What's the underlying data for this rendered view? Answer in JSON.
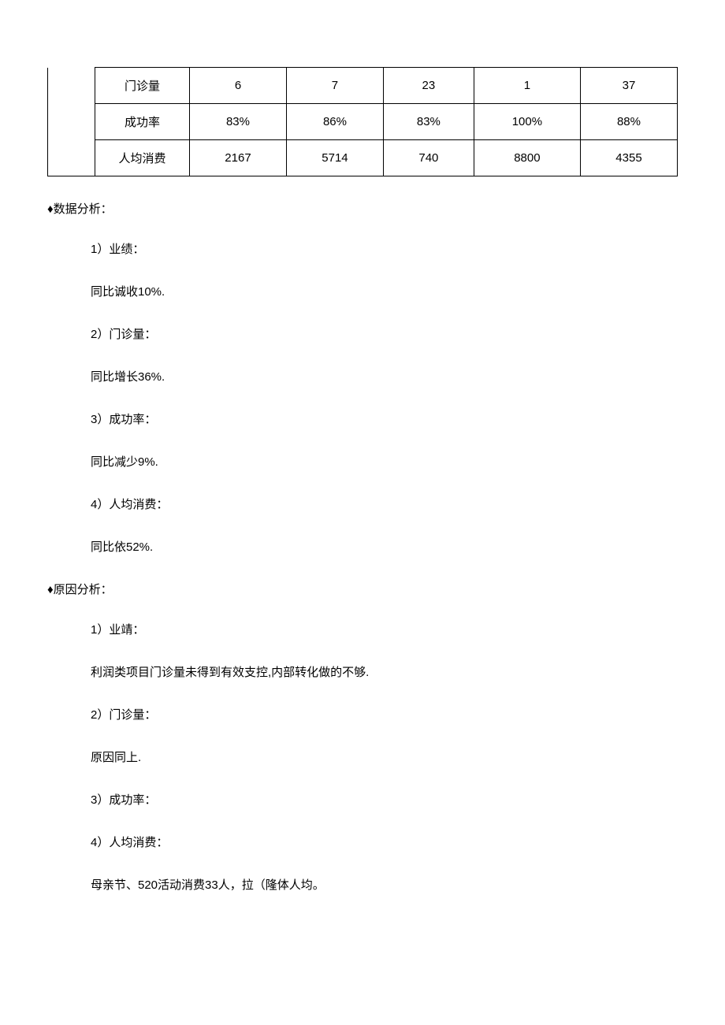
{
  "table": {
    "rows": [
      {
        "label": "门诊量",
        "c1": "6",
        "c2": "7",
        "c3": "23",
        "c4": "1",
        "c5": "37"
      },
      {
        "label": "成功率",
        "c1": "83%",
        "c2": "86%",
        "c3": "83%",
        "c4": "100%",
        "c5": "88%"
      },
      {
        "label": "人均消费",
        "c1": "2167",
        "c2": "5714",
        "c3": "740",
        "c4": "8800",
        "c5": "4355"
      }
    ]
  },
  "sections": {
    "data_analysis": {
      "heading": "♦数据分析：",
      "items": [
        {
          "num": "1）业绩：",
          "text": "同比诚收10%."
        },
        {
          "num": "2）门诊量：",
          "text": "同比增长36%."
        },
        {
          "num": "3）成功率：",
          "text": "同比减少9%."
        },
        {
          "num": "4）人均消费：",
          "text": "同比依52%."
        }
      ]
    },
    "cause_analysis": {
      "heading": "♦原因分析：",
      "items": [
        {
          "num": "1）业靖：",
          "text": "利润类项目门诊量未得到有效支控,内部转化做的不够."
        },
        {
          "num": "2）门诊量：",
          "text": "原因同上."
        },
        {
          "num": "3）成功率：",
          "text": ""
        },
        {
          "num": "4）人均消费：",
          "text": "母亲节、520活动消费33人，拉（隆体人均。"
        }
      ]
    }
  }
}
